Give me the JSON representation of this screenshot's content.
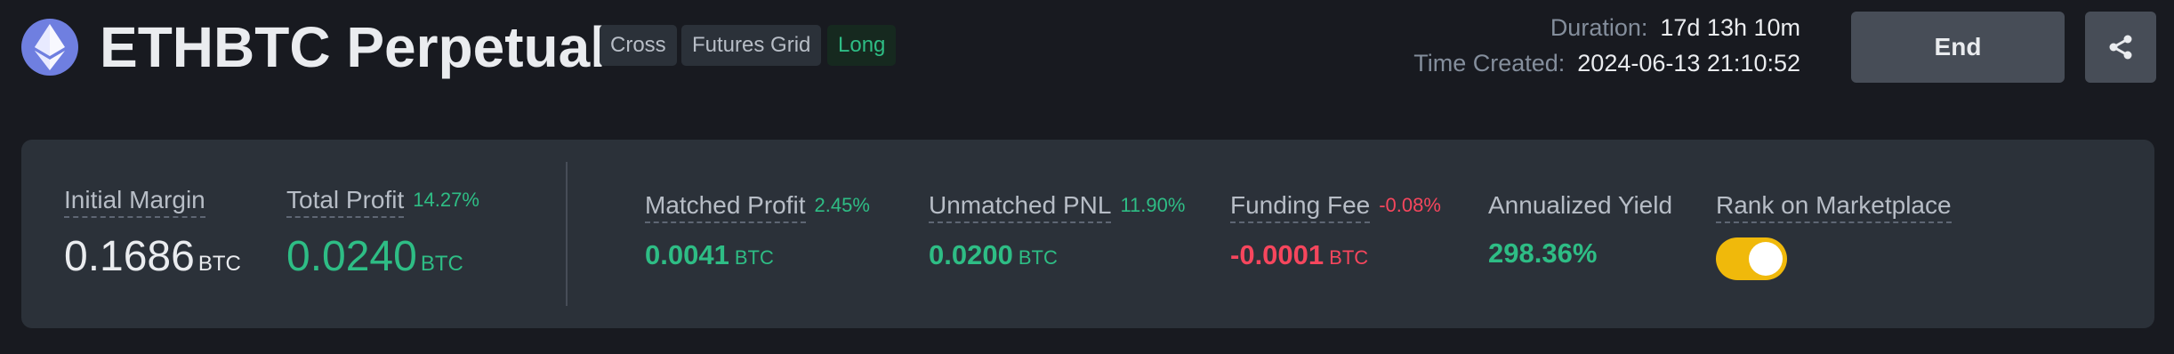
{
  "header": {
    "coin_icon": "ethereum-icon",
    "title": "ETHBTC Perpetual",
    "tags": [
      "Cross",
      "Futures Grid",
      "Long"
    ],
    "duration_label": "Duration:",
    "duration_value": "17d 13h 10m",
    "created_label": "Time Created:",
    "created_value": "2024-06-13 21:10:52",
    "end_label": "End",
    "share_icon": "share-icon"
  },
  "stats": {
    "initial_margin": {
      "label": "Initial Margin",
      "value": "0.1686",
      "unit": "BTC"
    },
    "total_profit": {
      "label": "Total Profit",
      "pct": "14.27%",
      "value": "0.0240",
      "unit": "BTC"
    },
    "matched_profit": {
      "label": "Matched Profit",
      "pct": "2.45%",
      "value": "0.0041",
      "unit": "BTC"
    },
    "unmatched_pnl": {
      "label": "Unmatched PNL",
      "pct": "11.90%",
      "value": "0.0200",
      "unit": "BTC"
    },
    "funding_fee": {
      "label": "Funding Fee",
      "pct": "-0.08%",
      "value": "-0.0001",
      "unit": "BTC"
    },
    "annualized_yield": {
      "label": "Annualized Yield",
      "value": "298.36%"
    },
    "rank_on_marketplace": {
      "label": "Rank on Marketplace",
      "enabled": true
    }
  },
  "colors": {
    "positive": "#2ebd85",
    "negative": "#f6465d",
    "toggle_on": "#f0b90b",
    "background": "#181a20",
    "panel": "#2b3139"
  }
}
